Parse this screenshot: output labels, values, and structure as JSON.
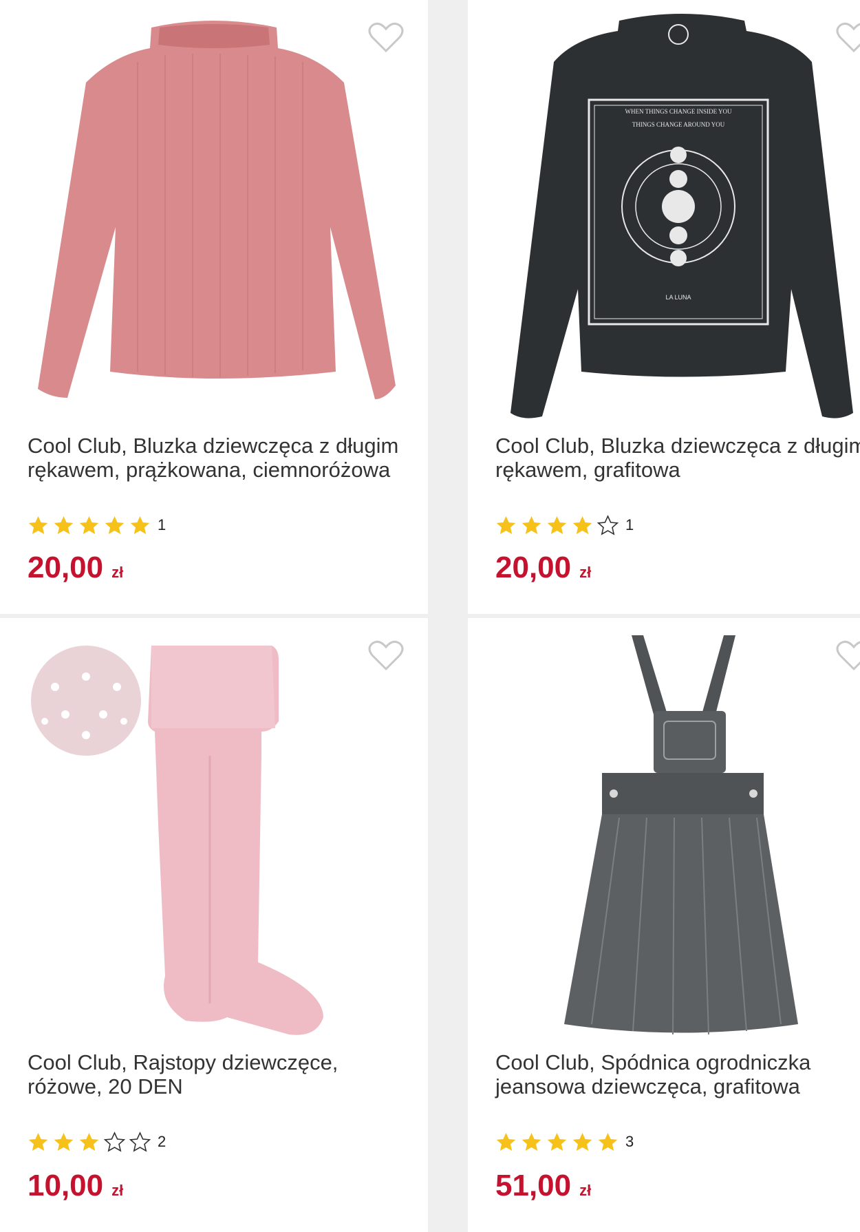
{
  "products": [
    {
      "title": "Cool Club, Bluzka dziewczęca z długim rękawem, prążkowana, ciemnoróżowa",
      "rating": 5,
      "review_count": "1",
      "price": "20,00",
      "currency": "zł",
      "image": "pink-ribbed-longsleeve",
      "image_color": "#d98a8c"
    },
    {
      "title": "Cool Club, Bluzka dziewczęca z długim rękawem, grafitowa",
      "rating": 4,
      "review_count": "1",
      "price": "20,00",
      "currency": "zł",
      "image": "graphite-longsleeve-print",
      "image_color": "#2d3033",
      "print_lines": [
        "WHEN THINGS CHANGE INSIDE YOU",
        "THINGS CHANGE AROUND YOU",
        "LA LUNA"
      ]
    },
    {
      "title": "Cool Club, Rajstopy dziewczęce, różowe, 20 DEN",
      "rating": 3,
      "review_count": "2",
      "price": "10,00",
      "currency": "zł",
      "image": "pink-tights",
      "image_color": "#efbcc6"
    },
    {
      "title": "Cool Club, Spódnica ogrodniczka jeansowa dziewczęca, grafitowa",
      "rating": 5,
      "review_count": "3",
      "price": "51,00",
      "currency": "zł",
      "image": "denim-pinafore-dress",
      "image_color": "#505355"
    }
  ],
  "colors": {
    "price": "#c4122f",
    "star_filled": "#f6c21a",
    "star_empty_outline": "#333333",
    "heart_outline": "#c8c8c8"
  },
  "icons": {
    "wishlist": "heart-outline-icon",
    "rating": "star-icon"
  }
}
